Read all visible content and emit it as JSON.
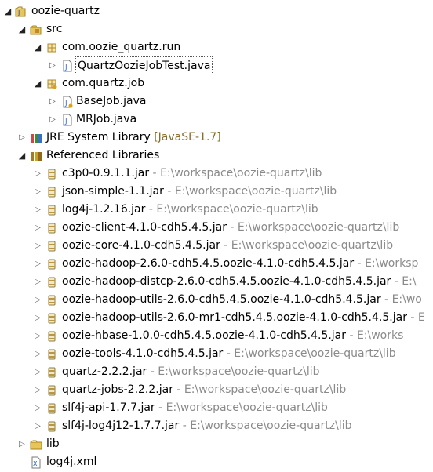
{
  "tree": {
    "project": {
      "label": "oozie-quartz"
    },
    "src": {
      "label": "src"
    },
    "pkg_run": {
      "label": "com.oozie_quartz.run"
    },
    "file_test": {
      "label": "QuartzOozieJobTest.java"
    },
    "pkg_job": {
      "label": "com.quartz.job"
    },
    "file_basejob": {
      "label": "BaseJob.java"
    },
    "file_mrjob": {
      "label": "MRJob.java"
    },
    "jre": {
      "label": "JRE System Library",
      "extra": "[JavaSE-1.7]"
    },
    "reflibs": {
      "label": "Referenced Libraries"
    },
    "jar_separator": " - ",
    "jars": [
      {
        "name": "c3p0-0.9.1.1.jar",
        "path": "E:\\workspace\\oozie-quartz\\lib"
      },
      {
        "name": "json-simple-1.1.jar",
        "path": "E:\\workspace\\oozie-quartz\\lib"
      },
      {
        "name": "log4j-1.2.16.jar",
        "path": "E:\\workspace\\oozie-quartz\\lib"
      },
      {
        "name": "oozie-client-4.1.0-cdh5.4.5.jar",
        "path": "E:\\workspace\\oozie-quartz\\lib"
      },
      {
        "name": "oozie-core-4.1.0-cdh5.4.5.jar",
        "path": "E:\\workspace\\oozie-quartz\\lib"
      },
      {
        "name": "oozie-hadoop-2.6.0-cdh5.4.5.oozie-4.1.0-cdh5.4.5.jar",
        "path": "E:\\worksp"
      },
      {
        "name": "oozie-hadoop-distcp-2.6.0-cdh5.4.5.oozie-4.1.0-cdh5.4.5.jar",
        "path": "E:\\"
      },
      {
        "name": "oozie-hadoop-utils-2.6.0-cdh5.4.5.oozie-4.1.0-cdh5.4.5.jar",
        "path": "E:\\wo"
      },
      {
        "name": "oozie-hadoop-utils-2.6.0-mr1-cdh5.4.5.oozie-4.1.0-cdh5.4.5.jar",
        "path": "E"
      },
      {
        "name": "oozie-hbase-1.0.0-cdh5.4.5.oozie-4.1.0-cdh5.4.5.jar",
        "path": "E:\\works"
      },
      {
        "name": "oozie-tools-4.1.0-cdh5.4.5.jar",
        "path": "E:\\workspace\\oozie-quartz\\lib"
      },
      {
        "name": "quartz-2.2.2.jar",
        "path": "E:\\workspace\\oozie-quartz\\lib"
      },
      {
        "name": "quartz-jobs-2.2.2.jar",
        "path": "E:\\workspace\\oozie-quartz\\lib"
      },
      {
        "name": "slf4j-api-1.7.7.jar",
        "path": "E:\\workspace\\oozie-quartz\\lib"
      },
      {
        "name": "slf4j-log4j12-1.7.7.jar",
        "path": "E:\\workspace\\oozie-quartz\\lib"
      }
    ],
    "lib": {
      "label": "lib"
    },
    "log4j": {
      "label": "log4j.xml"
    }
  },
  "colors": {
    "decoration": "#8a8a8a",
    "jre_decoration": "#8a6d2a",
    "package_icon": "#c9a227",
    "java_file_icon": "#3a6fc4",
    "folder_icon": "#e8c55a"
  },
  "icons": {
    "project": "java-project-icon",
    "src": "source-folder-icon",
    "package": "package-icon",
    "java_file": "java-file-icon",
    "library": "library-icon",
    "jar": "jar-icon",
    "folder": "folder-icon",
    "xml_file": "xml-file-icon"
  }
}
